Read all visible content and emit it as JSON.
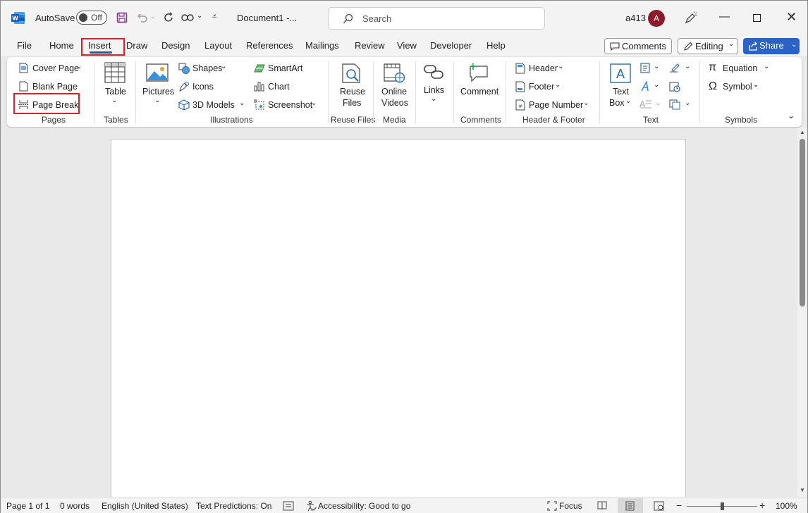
{
  "titlebar": {
    "autosave_label": "AutoSave",
    "autosave_state": "Off",
    "doc_title": "Document1  -...",
    "search_placeholder": "Search",
    "user_name": "a413",
    "avatar_letter": "A",
    "accent_color": "#2b579a"
  },
  "menu": {
    "tabs": [
      "File",
      "Home",
      "Insert",
      "Draw",
      "Design",
      "Layout",
      "References",
      "Mailings",
      "Review",
      "View",
      "Developer",
      "Help"
    ],
    "active_tab": "Insert",
    "comments_label": "Comments",
    "editing_label": "Editing",
    "share_label": "Share"
  },
  "ribbon": {
    "pages": {
      "cover_page": "Cover Page",
      "blank_page": "Blank Page",
      "page_break": "Page Break",
      "group": "Pages"
    },
    "tables": {
      "table_line1": "Table",
      "group": "Tables"
    },
    "illustrations": {
      "pictures": "Pictures",
      "shapes": "Shapes",
      "icons": "Icons",
      "models_3d": "3D Models",
      "smartart": "SmartArt",
      "chart": "Chart",
      "screenshot": "Screenshot",
      "group": "Illustrations"
    },
    "reuse": {
      "line1": "Reuse",
      "line2": "Files",
      "group": "Reuse Files"
    },
    "media": {
      "line1": "Online",
      "line2": "Videos",
      "group": "Media"
    },
    "links": {
      "label": "Links"
    },
    "comments": {
      "label": "Comment",
      "group": "Comments"
    },
    "header_footer": {
      "header": "Header",
      "footer": "Footer",
      "page_number": "Page Number",
      "group": "Header & Footer"
    },
    "text": {
      "line1": "Text",
      "line2": "Box",
      "group": "Text"
    },
    "symbols": {
      "equation": "Equation",
      "symbol": "Symbol",
      "group": "Symbols"
    }
  },
  "statusbar": {
    "page": "Page 1 of 1",
    "words": "0 words",
    "language": "English (United States)",
    "predictions": "Text Predictions: On",
    "accessibility": "Accessibility: Good to go",
    "focus": "Focus",
    "zoom": "100%"
  }
}
